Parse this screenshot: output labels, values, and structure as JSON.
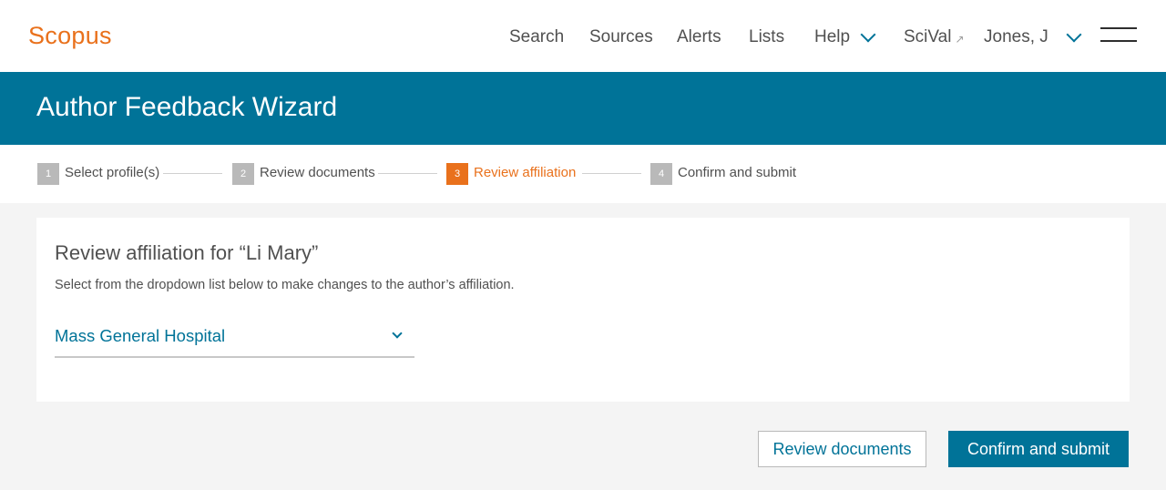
{
  "header": {
    "logo": "Scopus",
    "nav": {
      "search": "Search",
      "sources": "Sources",
      "alerts": "Alerts",
      "lists": "Lists",
      "help": "Help",
      "scival": "SciVal",
      "user": "Jones, J"
    }
  },
  "page_title": "Author Feedback Wizard",
  "steps": [
    {
      "number": "1",
      "label": "Select profile(s)",
      "state": "inactive"
    },
    {
      "number": "2",
      "label": "Review documents",
      "state": "inactive"
    },
    {
      "number": "3",
      "label": "Review affiliation",
      "state": "active"
    },
    {
      "number": "4",
      "label": "Confirm and submit",
      "state": "inactive"
    }
  ],
  "card": {
    "title": "Review affiliation for “Li Mary”",
    "description": "Select from the dropdown list below to make changes to the author’s affiliation.",
    "affiliation_selected": "Mass General Hospital"
  },
  "actions": {
    "back_label": "Review documents",
    "submit_label": "Confirm and submit"
  },
  "colors": {
    "brand_orange": "#e9711c",
    "primary_blue": "#007398"
  }
}
